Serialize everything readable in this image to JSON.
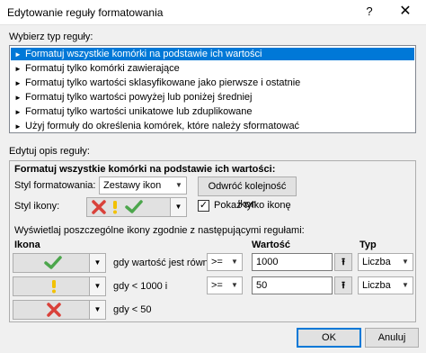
{
  "window": {
    "title": "Edytowanie reguły formatowania",
    "help_glyph": "?",
    "close_glyph": "✕"
  },
  "rule_type": {
    "label": "Wybierz typ reguły:",
    "items": [
      {
        "label": "Formatuj wszystkie komórki na podstawie ich wartości",
        "selected": true
      },
      {
        "label": "Formatuj tylko komórki zawierające",
        "selected": false
      },
      {
        "label": "Formatuj tylko wartości sklasyfikowane jako pierwsze i ostatnie",
        "selected": false
      },
      {
        "label": "Formatuj tylko wartości powyżej lub poniżej średniej",
        "selected": false
      },
      {
        "label": "Formatuj tylko wartości unikatowe lub zduplikowane",
        "selected": false
      },
      {
        "label": "Użyj formuły do określenia komórek, które należy sformatować",
        "selected": false
      }
    ]
  },
  "rule_desc": {
    "label": "Edytuj opis reguły:",
    "heading": "Formatuj wszystkie komórki na podstawie ich wartości:",
    "format_style_label": "Styl formatowania:",
    "format_style_value": "Zestawy ikon",
    "reverse_button": "Odwróć kolejność ikon",
    "icon_style_label": "Styl ikony:",
    "show_icon_only_label": "Pokaż tylko ikonę",
    "show_icon_only_checked": true,
    "rules_caption": "Wyświetlaj poszczególne ikony zgodnie z następującymi regułami:",
    "col_icon": "Ikona",
    "col_value": "Wartość",
    "col_type": "Typ",
    "rows": [
      {
        "icon": "green-check-icon",
        "condition": "gdy wartość jest równa",
        "operator": ">=",
        "value": "1000",
        "type": "Liczba"
      },
      {
        "icon": "yellow-exclamation-icon",
        "condition": "gdy < 1000 i",
        "operator": ">=",
        "value": "50",
        "type": "Liczba"
      },
      {
        "icon": "red-cross-icon",
        "condition": "gdy < 50"
      }
    ]
  },
  "footer": {
    "ok": "OK",
    "cancel": "Anuluj"
  },
  "colors": {
    "selection": "#0078d7",
    "green": "#4ca64c",
    "yellow": "#f2c100",
    "red": "#d9413a"
  }
}
